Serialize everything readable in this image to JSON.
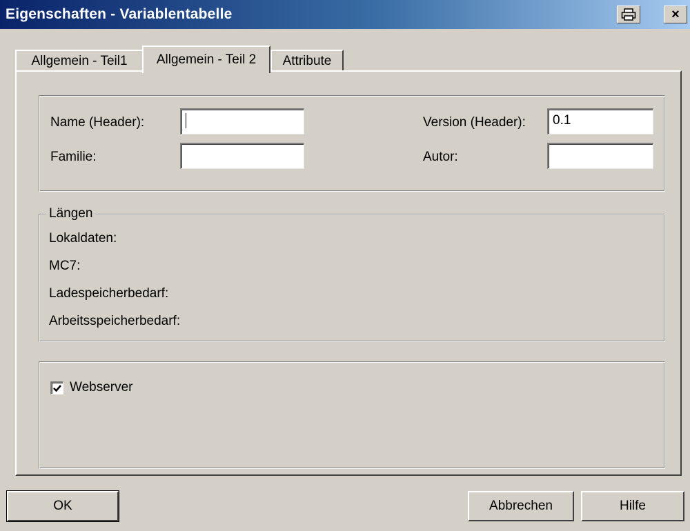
{
  "window": {
    "title": "Eigenschaften - Variablentabelle",
    "print_icon": "printer-icon",
    "close_label": "×"
  },
  "tabs": [
    {
      "label": "Allgemein - Teil1",
      "active": false
    },
    {
      "label": "Allgemein - Teil 2",
      "active": true
    },
    {
      "label": "Attribute",
      "active": false
    }
  ],
  "header_group": {
    "name_label": "Name (Header):",
    "name_value": "",
    "family_label": "Familie:",
    "family_value": "",
    "version_label": "Version (Header):",
    "version_value": "0.1",
    "author_label": "Autor:",
    "author_value": ""
  },
  "lengths_group": {
    "title": "Längen",
    "local_data_label": "Lokaldaten:",
    "mc7_label": "MC7:",
    "load_memory_label": "Ladespeicherbedarf:",
    "work_memory_label": "Arbeitsspeicherbedarf:"
  },
  "options_group": {
    "webserver_label": "Webserver",
    "webserver_checked": true
  },
  "buttons": {
    "ok": "OK",
    "cancel": "Abbrechen",
    "help": "Hilfe"
  },
  "colors": {
    "title_start": "#0a246a",
    "title_end": "#a6caf0",
    "face": "#d4d0c8"
  }
}
